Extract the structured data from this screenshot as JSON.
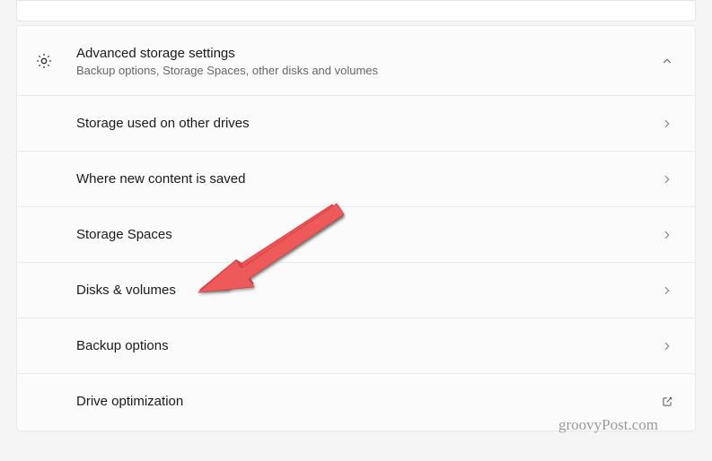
{
  "header": {
    "title": "Advanced storage settings",
    "subtitle": "Backup options, Storage Spaces, other disks and volumes"
  },
  "items": [
    {
      "label": "Storage used on other drives",
      "icon": "chevron-right"
    },
    {
      "label": "Where new content is saved",
      "icon": "chevron-right"
    },
    {
      "label": "Storage Spaces",
      "icon": "chevron-right"
    },
    {
      "label": "Disks & volumes",
      "icon": "chevron-right"
    },
    {
      "label": "Backup options",
      "icon": "chevron-right"
    },
    {
      "label": "Drive optimization",
      "icon": "external-link"
    }
  ],
  "watermark": "groovyPost.com",
  "colors": {
    "arrow": "#ee5555",
    "text": "#1a1a1a",
    "subtext": "#666666",
    "border": "#e8e8e8"
  }
}
